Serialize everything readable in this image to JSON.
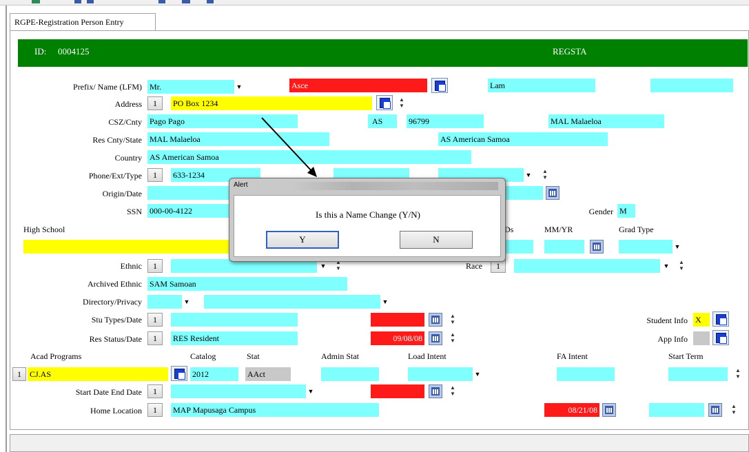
{
  "tab": {
    "label": "RGPE-Registration Person Entry"
  },
  "header": {
    "id_label": "ID:",
    "id_value": "0004125",
    "code": "REGSTA"
  },
  "row_prefix": {
    "label": "Prefix/ Name (LFM)",
    "prefix": "Mr.",
    "first": "Asce",
    "last": "Lam",
    "middle": ""
  },
  "row_address": {
    "label": "Address",
    "num": "1",
    "value": "PO Box 1234"
  },
  "row_csz": {
    "label": "CSZ/Cnty",
    "city": "Pago Pago",
    "state": "AS",
    "zip": "96799",
    "county": "MAL Malaeloa"
  },
  "row_res": {
    "label": "Res Cnty/State",
    "county": "MAL Malaeloa",
    "state": "AS American Samoa"
  },
  "row_country": {
    "label": "Country",
    "value": "AS American Samoa"
  },
  "row_phone": {
    "label": "Phone/Ext/Type",
    "num": "1",
    "value": "633-1234"
  },
  "row_origin": {
    "label": "Origin/Date"
  },
  "row_ssn": {
    "label": "SSN",
    "value": "000-00-4122",
    "gender_label": "Gender",
    "gender": "M"
  },
  "high_school": {
    "label": "High School",
    "ds_label": "Ds",
    "mmyr_label": "MM/YR",
    "grad_label": "Grad Type"
  },
  "row_ethnic": {
    "label": "Ethnic",
    "num": "1",
    "race_label": "Race",
    "race_num": "1"
  },
  "row_archived": {
    "label": "Archived Ethnic",
    "value": "SAM Samoan"
  },
  "row_directory": {
    "label": "Directory/Privacy"
  },
  "row_stu": {
    "label": "Stu Types/Date",
    "num": "1",
    "student_info_label": "Student Info",
    "student_info": "X"
  },
  "row_resstatus": {
    "label": "Res Status/Date",
    "num": "1",
    "value": "RES Resident",
    "date": "09/08/08",
    "app_info_label": "App Info"
  },
  "acad": {
    "headers": [
      "Acad Programs",
      "Catalog",
      "Stat",
      "Admin Stat",
      "Load Intent",
      "FA Intent",
      "Start Term"
    ],
    "num": "1",
    "program": "CJ.AS",
    "catalog": "2012",
    "stat": "AAct"
  },
  "row_startdate": {
    "label": "Start Date End Date",
    "num": "1"
  },
  "row_home": {
    "label": "Home Location",
    "num": "1",
    "value": "MAP Mapusaga Campus",
    "date": "08/21/08"
  },
  "alert": {
    "title": "Alert",
    "message": "Is this a Name Change (Y/N)",
    "yes": "Y",
    "no": "N"
  },
  "colors": {
    "header_green": "#008000",
    "field_cyan": "#80ffff",
    "field_yellow": "#ffff00",
    "field_red": "#ff1a1a"
  }
}
